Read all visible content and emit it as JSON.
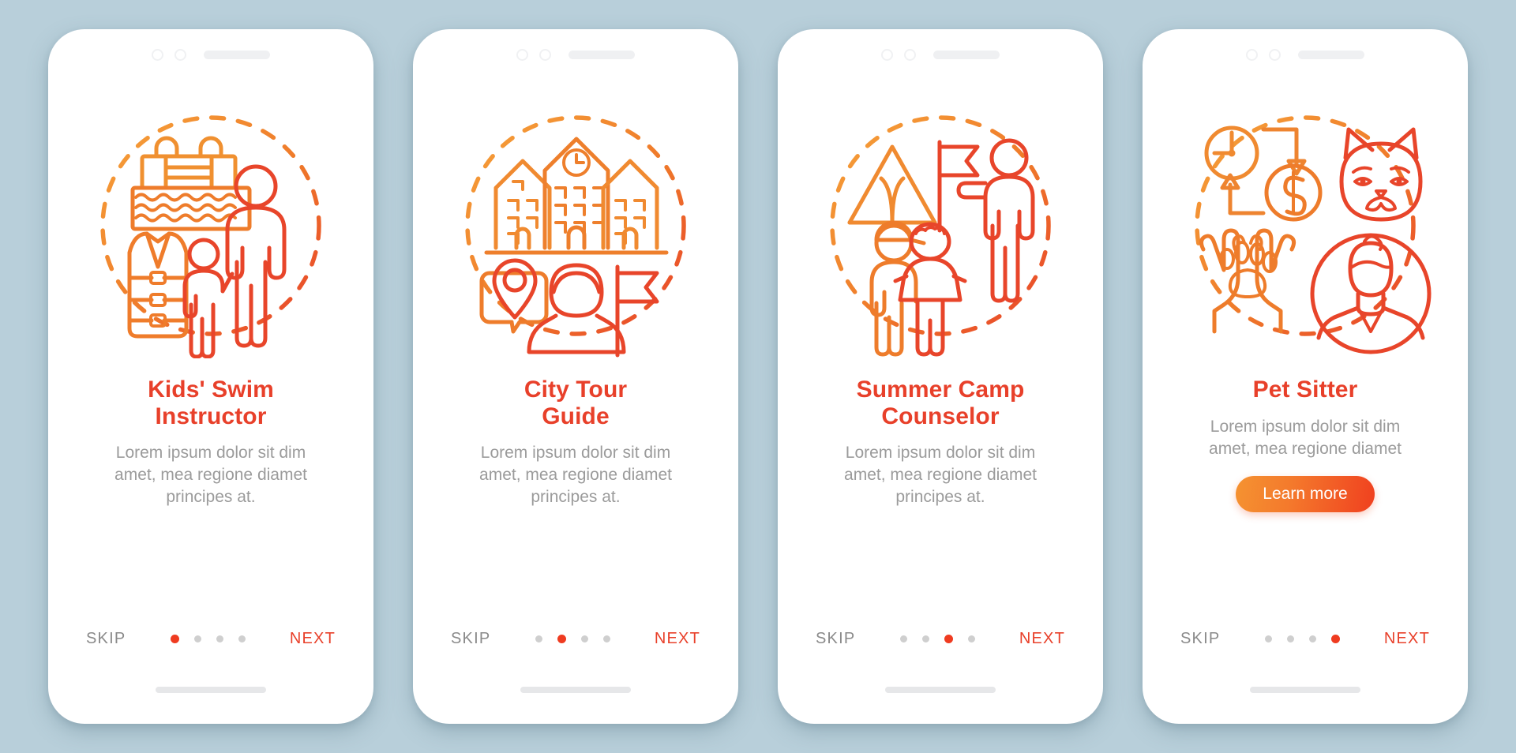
{
  "app": {
    "background_color": "#b8cfda",
    "accent_color": "#e8402a",
    "accent_gradient_start": "#f59331",
    "accent_gradient_end": "#f0401f",
    "muted_text_color": "#9b9b9b",
    "dot_inactive_color": "#cfcfcf",
    "dot_active_color": "#ef3b20"
  },
  "screens": [
    {
      "illustration_name": "kids-swim-instructor-illustration",
      "title": "Kids' Swim\nInstructor",
      "description": "Lorem ipsum dolor sit dim\namet, mea regione diamet\nprincipes at.",
      "skip_label": "SKIP",
      "next_label": "NEXT",
      "active_dot": 0,
      "dot_count": 4,
      "cta_label": null
    },
    {
      "illustration_name": "city-tour-guide-illustration",
      "title": "City Tour\nGuide",
      "description": "Lorem ipsum dolor sit dim\namet, mea regione diamet\nprincipes at.",
      "skip_label": "SKIP",
      "next_label": "NEXT",
      "active_dot": 1,
      "dot_count": 4,
      "cta_label": null
    },
    {
      "illustration_name": "summer-camp-counselor-illustration",
      "title": "Summer Camp\nCounselor",
      "description": "Lorem ipsum dolor sit dim\namet, mea regione diamet\nprincipes at.",
      "skip_label": "SKIP",
      "next_label": "NEXT",
      "active_dot": 2,
      "dot_count": 4,
      "cta_label": null
    },
    {
      "illustration_name": "pet-sitter-illustration",
      "title": "Pet Sitter",
      "description": "Lorem ipsum dolor sit dim\namet, mea regione diamet",
      "skip_label": "SKIP",
      "next_label": "NEXT",
      "active_dot": 3,
      "dot_count": 4,
      "cta_label": "Learn more"
    }
  ]
}
